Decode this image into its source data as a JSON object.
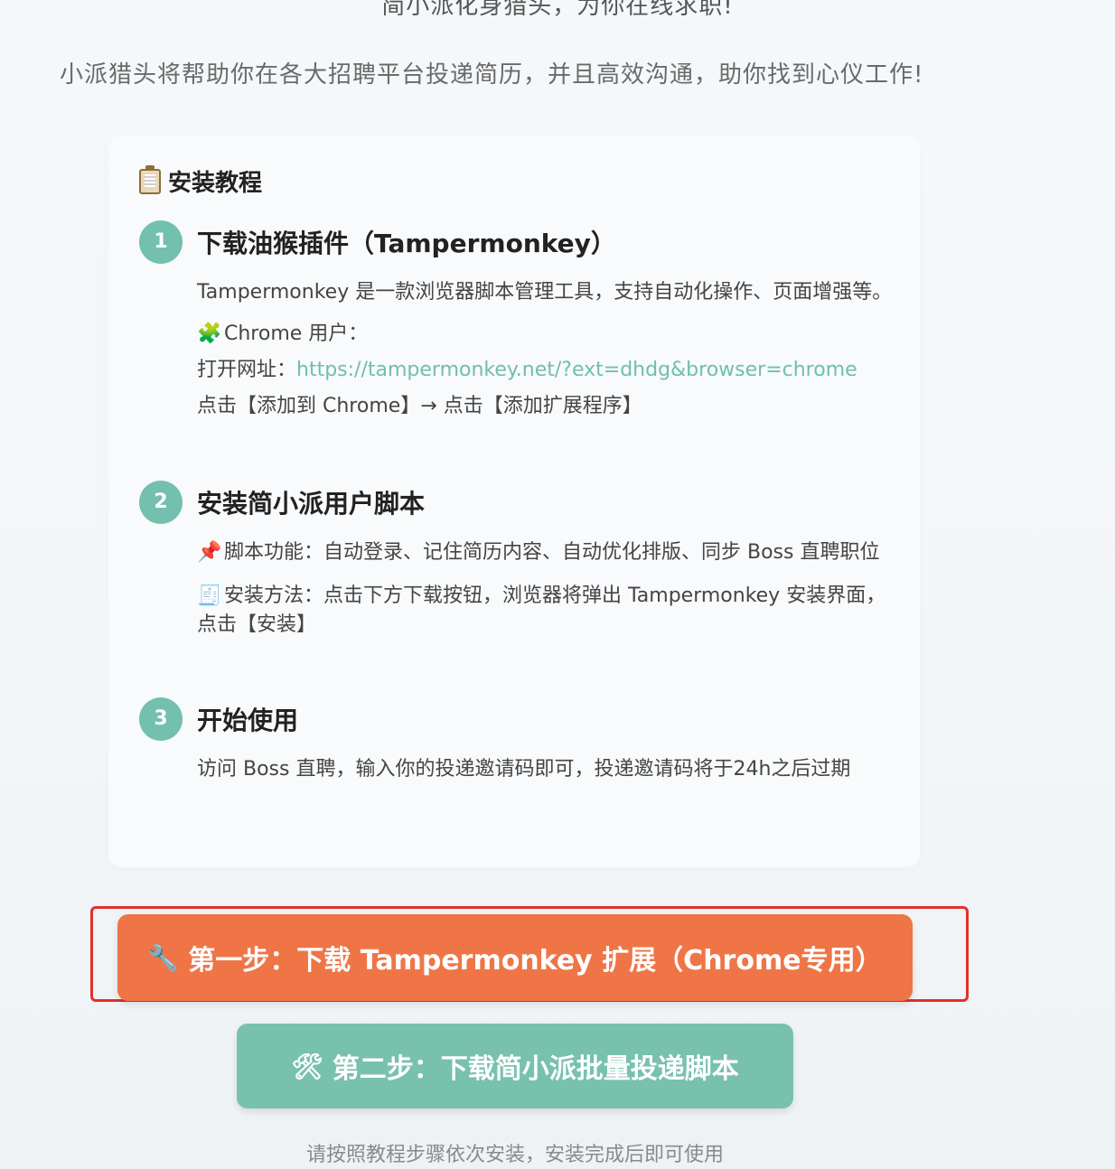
{
  "hero": {
    "title": "简小派化身猎头，为你在线求职!",
    "subtitle": "小派猎头将帮助你在各大招聘平台投递简历，并且高效沟通，助你找到心仪工作!"
  },
  "tutorial": {
    "title": "安装教程",
    "steps": [
      {
        "number": "1",
        "title": "下载油猴插件（Tampermonkey）",
        "desc": "Tampermonkey 是一款浏览器脚本管理工具，支持自动化操作、页面增强等。",
        "chrome_label": "Chrome 用户：",
        "open_url_label": "打开网址：",
        "url": "https://tampermonkey.net/?ext=dhdg&browser=chrome",
        "instruction": "点击【添加到 Chrome】→ 点击【添加扩展程序】"
      },
      {
        "number": "2",
        "title": "安装简小派用户脚本",
        "features": "脚本功能：自动登录、记住简历内容、自动优化排版、同步 Boss 直聘职位",
        "method": "安装方法：点击下方下载按钮，浏览器将弹出 Tampermonkey 安装界面，点击【安装】"
      },
      {
        "number": "3",
        "title": "开始使用",
        "desc": "访问 Boss 直聘，输入你的投递邀请码即可，投递邀请码将于24h之后过期"
      }
    ]
  },
  "buttons": {
    "step1": "第一步：下载 Tampermonkey 扩展（Chrome专用）",
    "step2": "第二步：下载简小派批量投递脚本"
  },
  "footer_note": "请按照教程步骤依次安装，安装完成后即可使用",
  "icons": {
    "tutorial": "clipboard-icon",
    "chrome": "puzzle-piece-icon",
    "features": "pushpin-icon",
    "method": "receipt-icon",
    "step1_button": "wrench-icon",
    "step2_button": "hammer-and-wrench-icon"
  },
  "colors": {
    "accent_green": "#72c0ad",
    "link_green": "#6fc0a8",
    "primary_orange": "#ef7547",
    "highlight_red": "#e1302a"
  }
}
